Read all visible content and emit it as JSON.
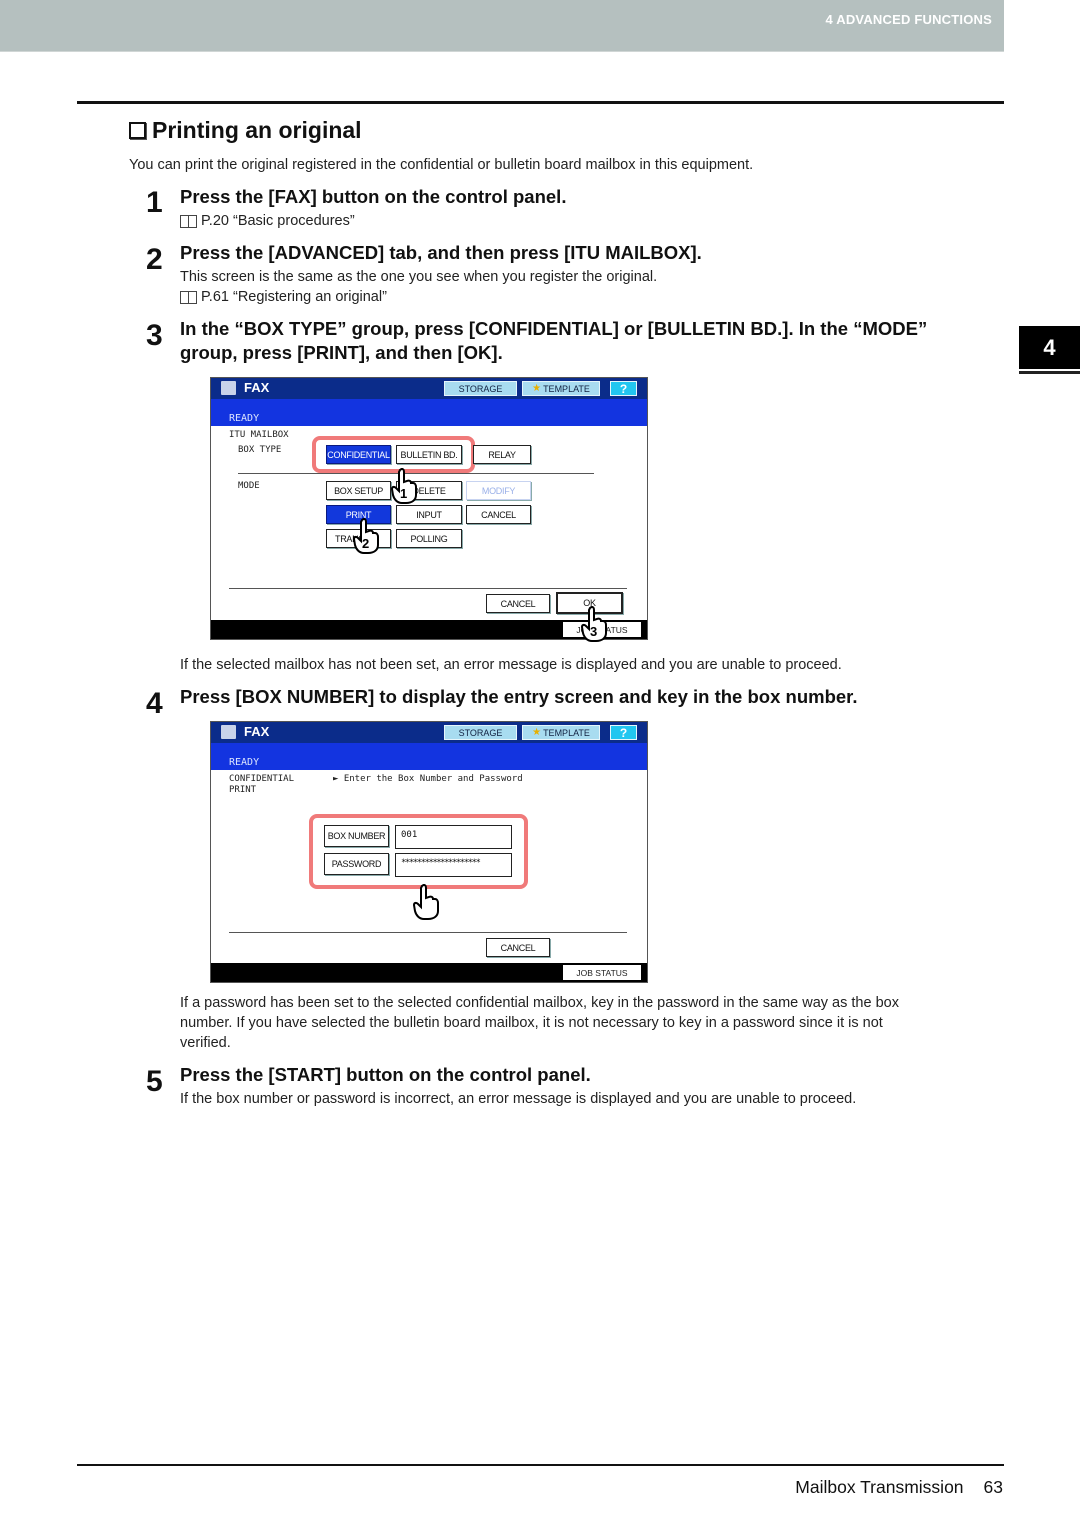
{
  "header": {
    "chapter": "4 ADVANCED FUNCTIONS"
  },
  "section": {
    "title": "Printing an original",
    "intro": "You can print the original registered in the confidential or bulletin board mailbox in this equipment."
  },
  "side_tab": "4",
  "steps": [
    {
      "num": "1",
      "title": "Press the [FAX] button on the control panel.",
      "ref": "P.20 “Basic procedures”"
    },
    {
      "num": "2",
      "title": "Press the [ADVANCED] tab, and then press [ITU MAILBOX].",
      "text": "This screen is the same as the one you see when you register the original.",
      "ref": "P.61 “Registering an original”"
    },
    {
      "num": "3",
      "title_line1": "In the “BOX TYPE” group, press [CONFIDENTIAL] or [BULLETIN BD.]. In the “MODE”",
      "title_line2": "group, press [PRINT], and then [OK].",
      "note": "If the selected mailbox has not been set, an error message is displayed and you are unable to proceed."
    },
    {
      "num": "4",
      "title": "Press [BOX NUMBER] to display the entry screen and key in the box number.",
      "note_line1": "If a password has been set to the selected confidential mailbox, key in the password in the same way as the box",
      "note_line2": "number. If you have selected the bulletin board mailbox, it is not necessary to key in a password since it is not",
      "note_line3": "verified."
    },
    {
      "num": "5",
      "title": "Press the [START] button on the control panel.",
      "text": "If the box number or password is incorrect, an error message is displayed and you are unable to proceed."
    }
  ],
  "screen1": {
    "title": "FAX",
    "storage": "STORAGE",
    "template": "TEMPLATE",
    "help": "?",
    "status": "READY",
    "mailbox_label": "ITU MAILBOX",
    "box_type_label": "BOX TYPE",
    "mode_label": "MODE",
    "box_type_buttons": [
      "CONFIDENTIAL",
      "BULLETIN BD.",
      "RELAY"
    ],
    "mode_buttons": [
      "BOX SETUP",
      "DELETE",
      "MODIFY",
      "PRINT",
      "INPUT",
      "CANCEL",
      "TRANSMIT",
      "POLLING"
    ],
    "cancel": "CANCEL",
    "ok": "OK",
    "job_status": "JOB STATUS",
    "callouts": [
      "1",
      "2",
      "3"
    ]
  },
  "screen2": {
    "title": "FAX",
    "storage": "STORAGE",
    "template": "TEMPLATE",
    "help": "?",
    "status": "READY",
    "line1": "CONFIDENTIAL",
    "line2": "PRINT",
    "instruction": "► Enter the Box Number and Password",
    "box_number_label": "BOX NUMBER",
    "box_number_value": "001",
    "password_label": "PASSWORD",
    "password_value": "********************",
    "cancel": "CANCEL",
    "job_status": "JOB STATUS"
  },
  "footer": {
    "section": "Mailbox Transmission",
    "page": "63"
  }
}
